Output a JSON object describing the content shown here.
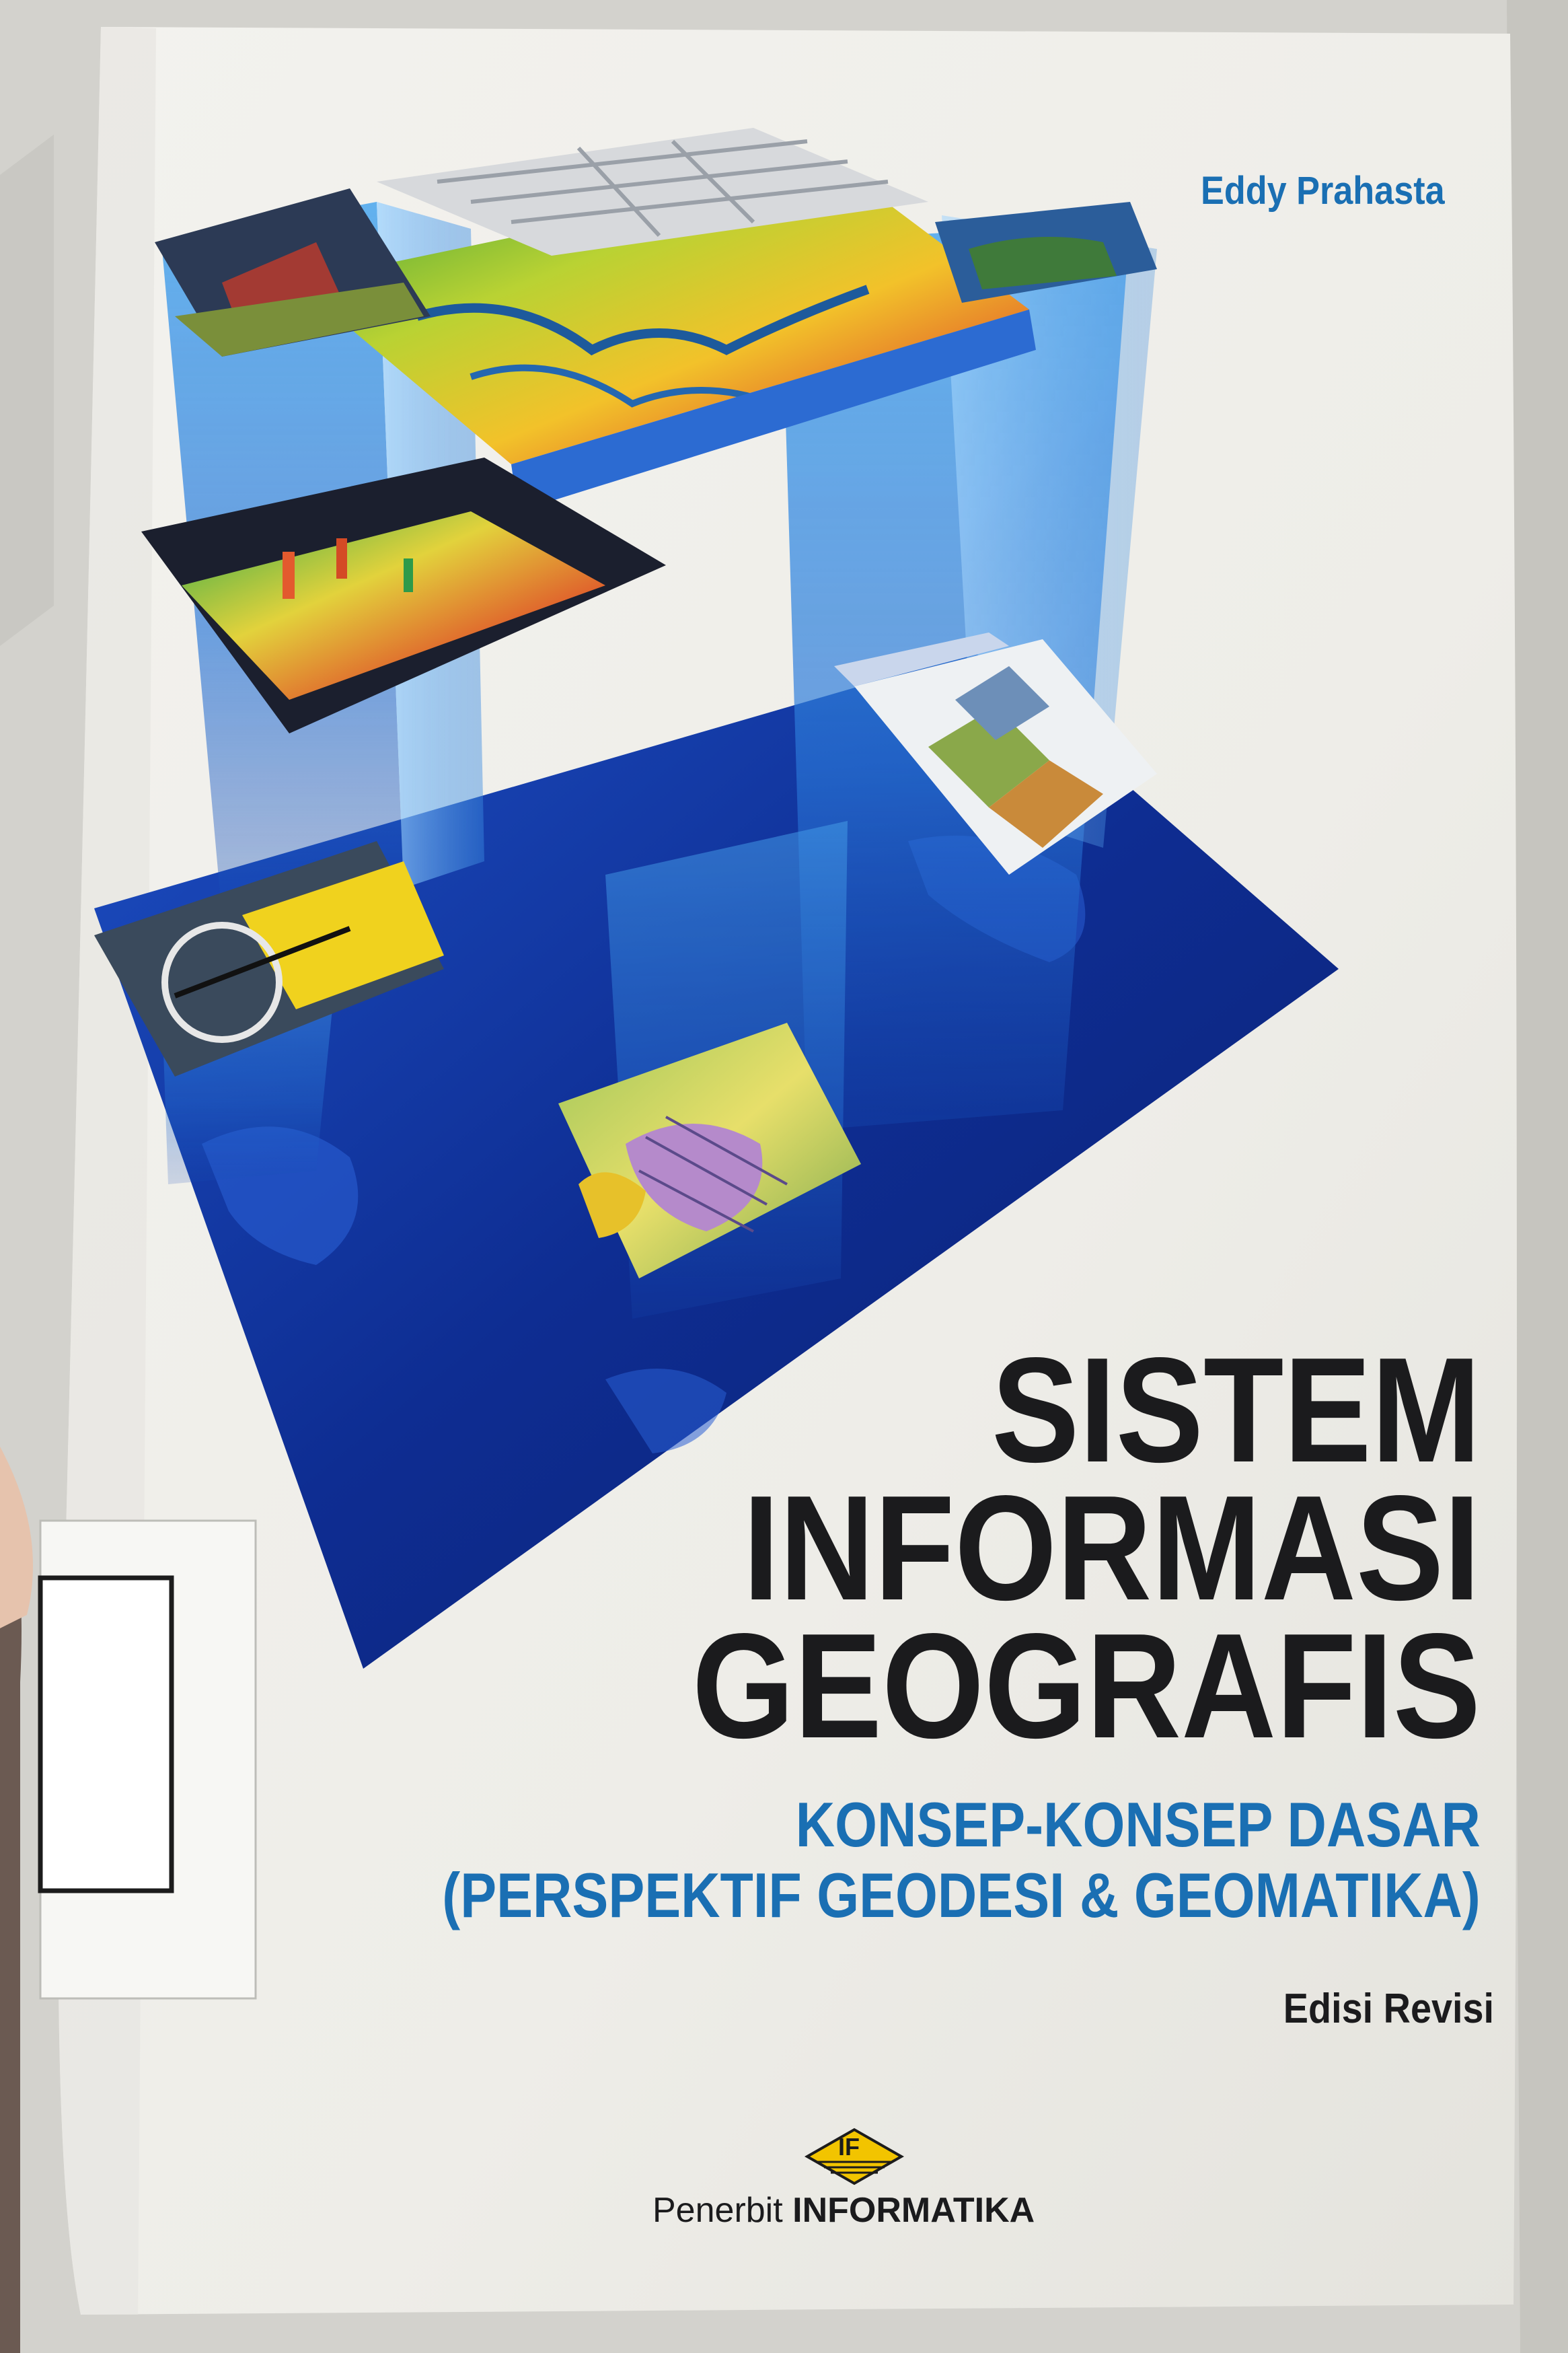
{
  "cover": {
    "author": "Eddy Prahasta",
    "title_line1": "SISTEM",
    "title_line2": "INFORMASI",
    "title_line3": "GEOGRAFIS",
    "subtitle_line1": "KONSEP-KONSEP DASAR",
    "subtitle_line2": "(PERSPEKTIF GEODESI & GEOMATIKA)",
    "edition": "Edisi Revisi",
    "logo_mark": "IF",
    "publisher_prefix": "Penerbit",
    "publisher_name": "INFORMATIKA"
  },
  "colors": {
    "cover_paper": "#f1f0ec",
    "title_black": "#1b1b1d",
    "subtitle_blue": "#1a6fb3",
    "author_blue": "#1a6fb3",
    "deep_blue": "#0d2c8c",
    "logo_yellow": "#f2c400"
  },
  "icons": [
    "if-logo-icon",
    "library-label-sticker"
  ]
}
